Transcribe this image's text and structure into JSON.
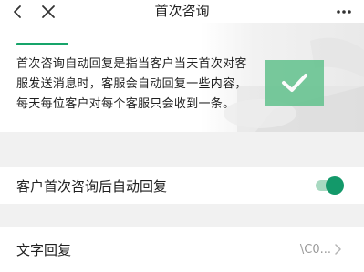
{
  "nav": {
    "title": "首次咨询",
    "back_icon": "chevron-left-icon",
    "close_icon": "close-icon",
    "more_icon": "more-dots-icon"
  },
  "banner": {
    "description": "首次咨询自动回复是指当客户当天首次对客服发送消息时，客服会自动回复一些内容，每天每位客户对每个客服只会收到一条。",
    "badge_icon": "checkmark-icon",
    "accent_color": "#17a46a"
  },
  "settings": {
    "auto_reply": {
      "label": "客户首次咨询后自动回复",
      "enabled": true,
      "toggle_color": "#13996a"
    },
    "text_reply": {
      "label": "文字回复",
      "value": "\\C0...",
      "chevron_icon": "chevron-right-icon"
    }
  }
}
